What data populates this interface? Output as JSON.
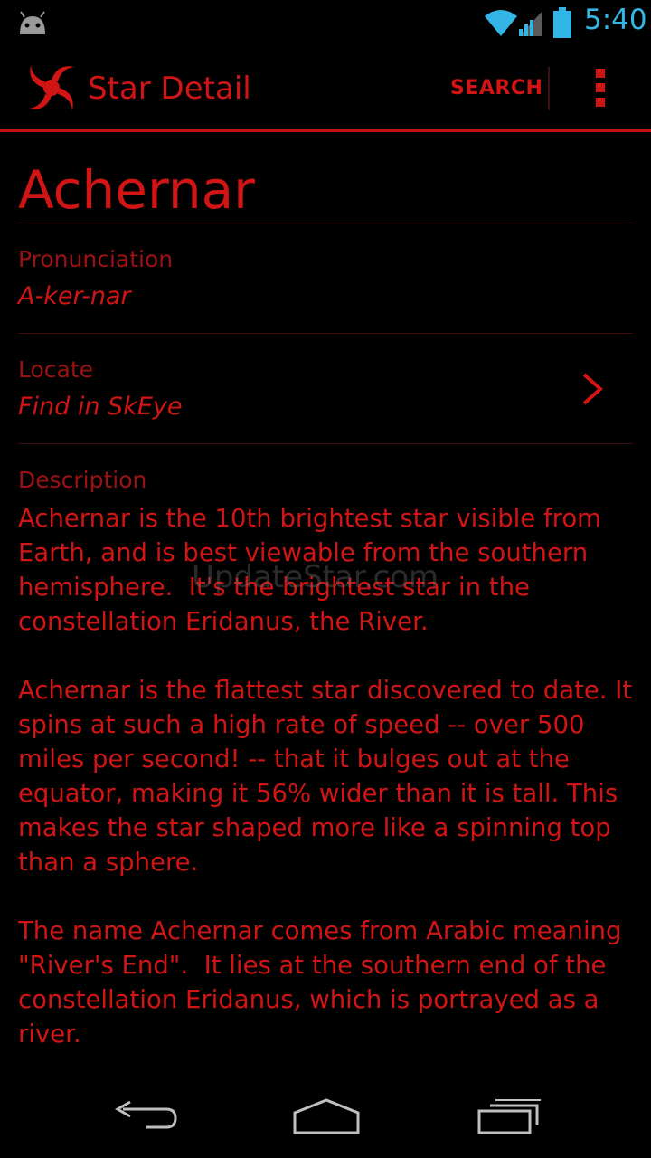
{
  "status_bar": {
    "time": "5:40",
    "icons": [
      "android-icon",
      "wifi-icon",
      "signal-icon",
      "battery-icon"
    ]
  },
  "action_bar": {
    "title": "Star Detail",
    "search_label": "SEARCH",
    "icons": [
      "app-logo-icon",
      "overflow-menu-icon"
    ]
  },
  "star": {
    "name": "Achernar",
    "pronunciation_label": "Pronunciation",
    "pronunciation_value": "A-ker-nar",
    "locate_label": "Locate",
    "locate_value": "Find in SkEye",
    "description_label": "Description",
    "description_text": "Achernar is the 10th brightest star visible from Earth, and is best viewable from the southern hemisphere.  It's the brightest star in the constellation Eridanus, the River.\n\nAchernar is the flattest star discovered to date. It spins at such a high rate of speed -- over 500 miles per second! -- that it bulges out at the equator, making it 56% wider than it is tall. This makes the star shaped more like a spinning top than a sphere.\n\nThe name Achernar comes from Arabic meaning \"River's End\".  It lies at the southern end of the constellation Eridanus, which is portrayed as a river."
  },
  "watermark": "UpdateStar.com",
  "nav_bar": {
    "icons": [
      "back-icon",
      "home-icon",
      "recent-apps-icon"
    ]
  },
  "colors": {
    "accent": "#d11414",
    "label": "#9c1212",
    "background": "#000000",
    "status_blue": "#33b5e5"
  }
}
